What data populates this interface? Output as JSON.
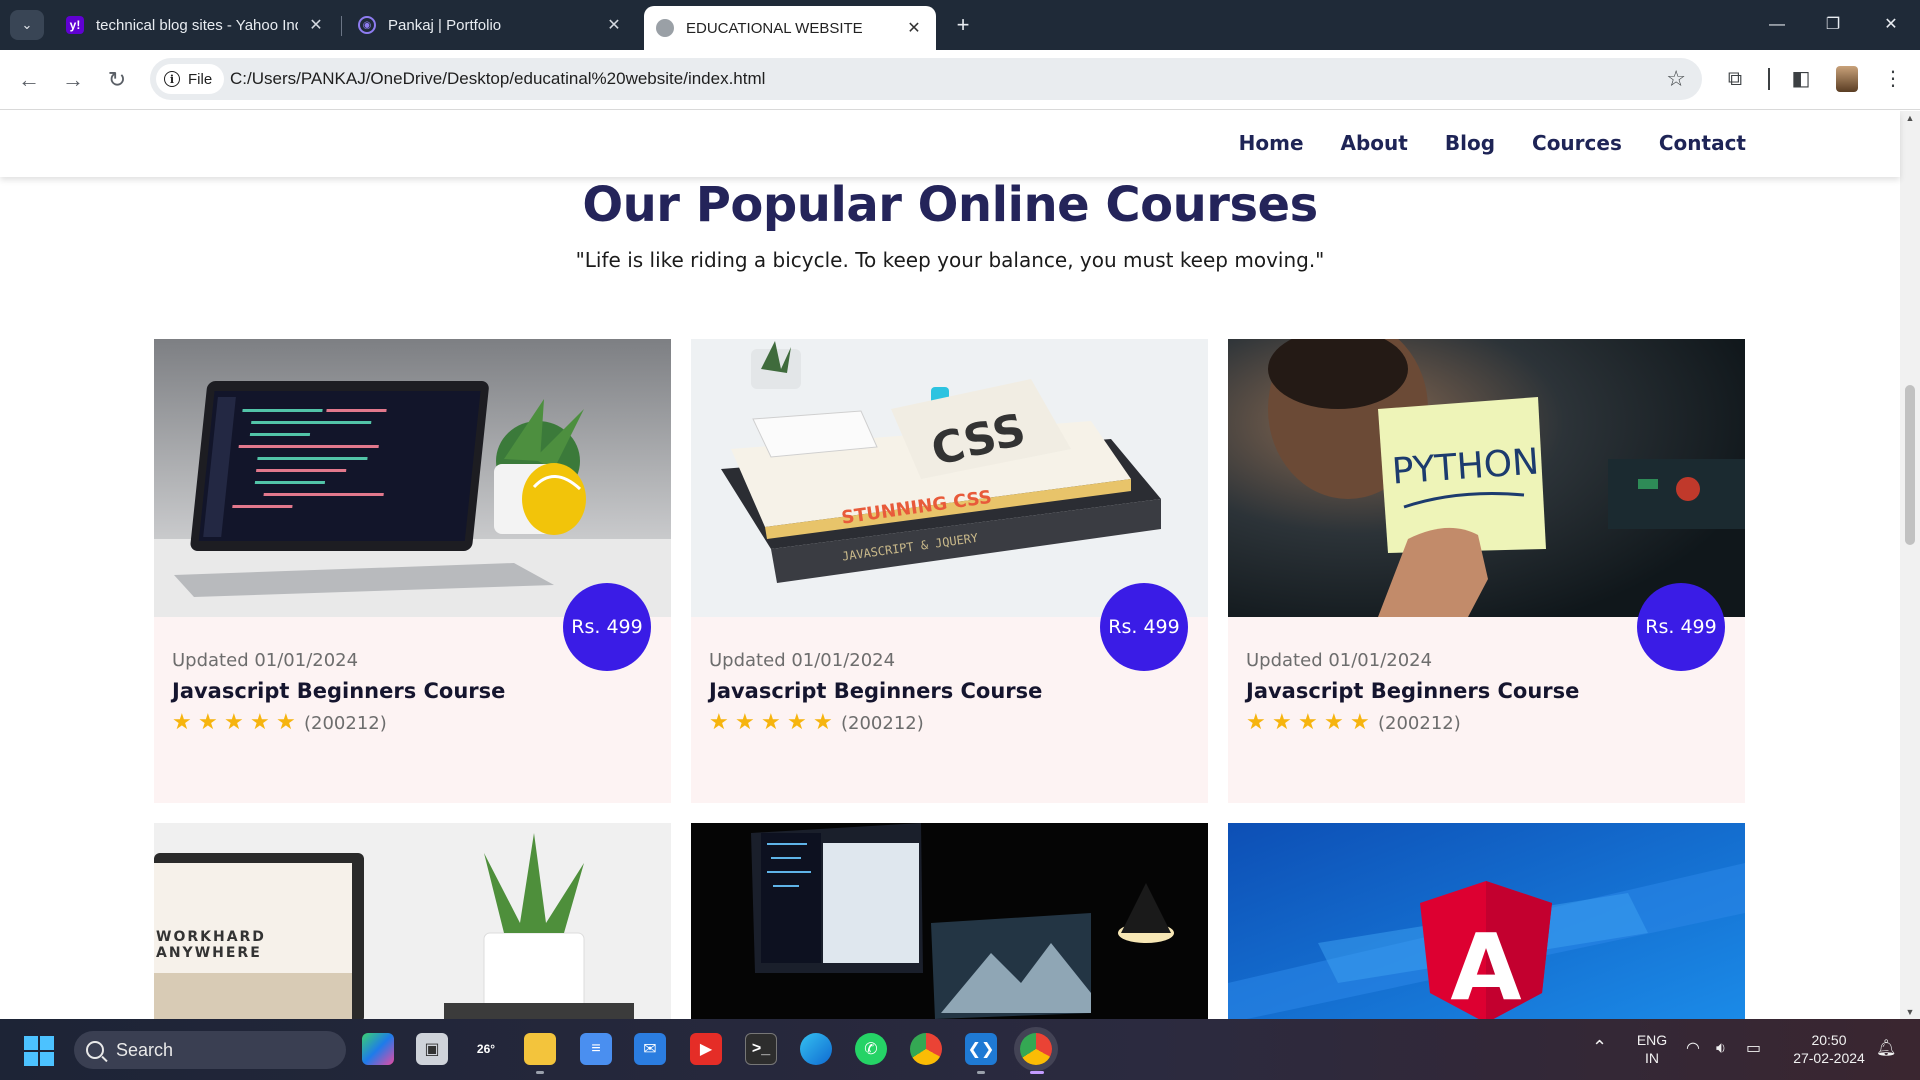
{
  "browser": {
    "tabs": [
      {
        "title": "technical blog sites - Yahoo India",
        "favicon": "yahoo-icon",
        "active": false
      },
      {
        "title": "Pankaj | Portfolio",
        "favicon": "portfolio-icon",
        "active": false
      },
      {
        "title": "EDUCATIONAL WEBSITE",
        "favicon": "globe-icon",
        "active": true
      }
    ],
    "address": {
      "chip": "File",
      "url": "C:/Users/PANKAJ/OneDrive/Desktop/educatinal%20website/index.html"
    }
  },
  "site": {
    "nav": [
      "Home",
      "About",
      "Blog",
      "Cources",
      "Contact"
    ],
    "section": {
      "title": "Our Popular Online Courses",
      "quote": "\"Life is like riding a bicycle. To keep your balance, you must keep moving.\""
    },
    "courses": [
      {
        "price": "Rs. 499",
        "updated": "Updated 01/01/2024",
        "title": "Javascript Beginners Course",
        "stars": 5,
        "reviews": "(200212)",
        "image": "laptop-code-desk"
      },
      {
        "price": "Rs. 499",
        "updated": "Updated 01/01/2024",
        "title": "Javascript Beginners Course",
        "stars": 5,
        "reviews": "(200212)",
        "image": "css-books-phone"
      },
      {
        "price": "Rs. 499",
        "updated": "Updated 01/01/2024",
        "title": "Javascript Beginners Course",
        "stars": 5,
        "reviews": "(200212)",
        "image": "python-sticky-note"
      }
    ],
    "second_row_images": [
      "workhard-laptop-plant",
      "dark-monitors-desk",
      "angular-logo"
    ],
    "workhard_text": "WORKHARD\nANYWHERE",
    "angular_letter": "A",
    "python_text": "PYTHON",
    "css_book_text": "STUNNING CSS",
    "css_letters": "CSS"
  },
  "taskbar": {
    "search_label": "Search",
    "weather": "26°",
    "lang": "ENG",
    "region": "IN",
    "time": "20:50",
    "date": "27-02-2024",
    "colors": {
      "price_badge": "#3a1ce6",
      "nav_text": "#1e2456",
      "card_bg": "#fdf3f3",
      "star": "#f6b40e"
    }
  }
}
